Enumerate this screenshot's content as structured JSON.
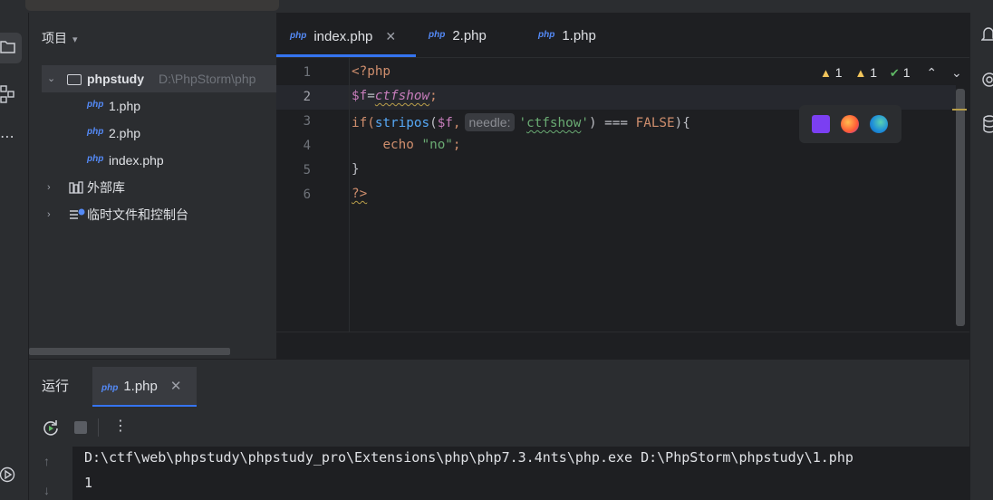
{
  "project": {
    "title": "项目",
    "root": {
      "name": "phpstudy",
      "path": "D:\\PhpStorm\\php"
    },
    "files": [
      {
        "icon_label": "php",
        "name": "1.php"
      },
      {
        "icon_label": "php",
        "name": "2.php"
      },
      {
        "icon_label": "php",
        "name": "index.php"
      }
    ],
    "external_libraries": "外部库",
    "scratches": "临时文件和控制台"
  },
  "editor": {
    "tabs": [
      {
        "icon_label": "php",
        "name": "index.php",
        "active": true
      },
      {
        "icon_label": "php",
        "name": "2.php"
      },
      {
        "icon_label": "php",
        "name": "1.php"
      }
    ],
    "line_numbers": [
      "1",
      "2",
      "3",
      "4",
      "5",
      "6"
    ],
    "code": {
      "l1": "<?php",
      "l2_var": "$f",
      "l2_eq": "=",
      "l2_const": "ctfshow",
      "l2_semi": ";",
      "l3_if": "if(",
      "l3_fn": "stripos",
      "l3_open": "(",
      "l3_var": "$f",
      "l3_comma": ",",
      "l3_hint": "needle:",
      "l3_q1": "'",
      "l3_str": "ctfshow",
      "l3_q2": "'",
      "l3_rest": ") === ",
      "l3_false": "FALSE",
      "l3_end": "){",
      "l4_echo": "echo",
      "l4_str": "\"no\"",
      "l4_semi": ";",
      "l5": "}",
      "l6": "?>"
    },
    "inspections": {
      "warnings_a": "1",
      "warnings_b": "1",
      "typos": "1"
    }
  },
  "run": {
    "title": "运行",
    "tab": {
      "icon_label": "php",
      "name": "1.php"
    },
    "console_lines": [
      "D:\\ctf\\web\\phpstudy\\phpstudy_pro\\Extensions\\php\\php7.3.4nts\\php.exe D:\\PhpStorm\\phpstudy\\1.php",
      "1"
    ]
  },
  "colors": {
    "accent": "#3574f0",
    "php_icon": "#548af7",
    "keyword": "#cf8e6d",
    "string": "#6aab73",
    "function": "#56a8f5",
    "variable": "#c77dbb",
    "warning": "#f2c55c"
  }
}
